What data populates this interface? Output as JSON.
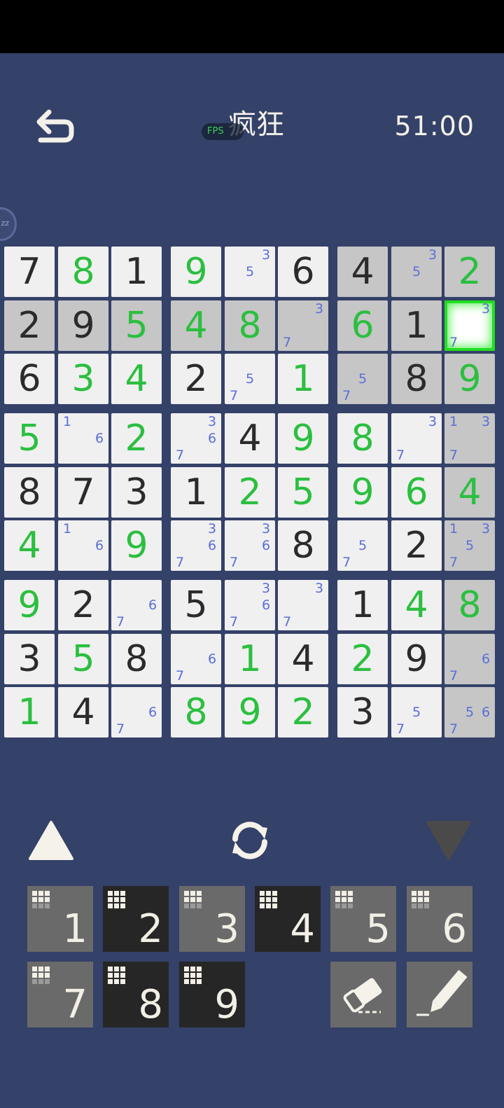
{
  "header": {
    "title": "疯狂",
    "fps_label": "FPS",
    "timer": "51:00",
    "sleep_label": "zz"
  },
  "board": {
    "selected": [
      1,
      8
    ],
    "rows": [
      [
        {
          "v": "7",
          "t": "given"
        },
        {
          "v": "8",
          "t": "user"
        },
        {
          "v": "1",
          "t": "given"
        },
        {
          "v": "9",
          "t": "user"
        },
        {
          "n": [
            "5",
            "3"
          ]
        },
        {
          "v": "6",
          "t": "given"
        },
        {
          "v": "4",
          "t": "given"
        },
        {
          "n": [
            "5",
            "3"
          ]
        },
        {
          "v": "2",
          "t": "user"
        }
      ],
      [
        {
          "v": "2",
          "t": "given"
        },
        {
          "v": "9",
          "t": "given"
        },
        {
          "v": "5",
          "t": "user"
        },
        {
          "v": "4",
          "t": "user"
        },
        {
          "v": "8",
          "t": "user"
        },
        {
          "n": [
            "3",
            "7"
          ]
        },
        {
          "v": "6",
          "t": "user"
        },
        {
          "v": "1",
          "t": "given"
        },
        {
          "n": [
            "3",
            "7"
          ]
        }
      ],
      [
        {
          "v": "6",
          "t": "given"
        },
        {
          "v": "3",
          "t": "user"
        },
        {
          "v": "4",
          "t": "user"
        },
        {
          "v": "2",
          "t": "given"
        },
        {
          "n": [
            "5",
            "7"
          ]
        },
        {
          "v": "1",
          "t": "user"
        },
        {
          "n": [
            "5",
            "7"
          ]
        },
        {
          "v": "8",
          "t": "given"
        },
        {
          "v": "9",
          "t": "user"
        }
      ],
      [
        {
          "v": "5",
          "t": "user"
        },
        {
          "n": [
            "1",
            "6"
          ]
        },
        {
          "v": "2",
          "t": "user"
        },
        {
          "n": [
            "3",
            "6",
            "7"
          ]
        },
        {
          "v": "4",
          "t": "given"
        },
        {
          "v": "9",
          "t": "user"
        },
        {
          "v": "8",
          "t": "user"
        },
        {
          "n": [
            "3",
            "7"
          ]
        },
        {
          "n": [
            "1",
            "3",
            "7"
          ]
        }
      ],
      [
        {
          "v": "8",
          "t": "given"
        },
        {
          "v": "7",
          "t": "given"
        },
        {
          "v": "3",
          "t": "given"
        },
        {
          "v": "1",
          "t": "given"
        },
        {
          "v": "2",
          "t": "user"
        },
        {
          "v": "5",
          "t": "user"
        },
        {
          "v": "9",
          "t": "user"
        },
        {
          "v": "6",
          "t": "user"
        },
        {
          "v": "4",
          "t": "user"
        }
      ],
      [
        {
          "v": "4",
          "t": "user"
        },
        {
          "n": [
            "1",
            "6"
          ]
        },
        {
          "v": "9",
          "t": "user"
        },
        {
          "n": [
            "3",
            "6",
            "7"
          ]
        },
        {
          "n": [
            "3",
            "6",
            "7"
          ]
        },
        {
          "v": "8",
          "t": "given"
        },
        {
          "n": [
            "5",
            "7"
          ]
        },
        {
          "v": "2",
          "t": "given"
        },
        {
          "n": [
            "1",
            "3",
            "5",
            "7"
          ]
        }
      ],
      [
        {
          "v": "9",
          "t": "user"
        },
        {
          "v": "2",
          "t": "given"
        },
        {
          "n": [
            "6",
            "7"
          ]
        },
        {
          "v": "5",
          "t": "given"
        },
        {
          "n": [
            "3",
            "6",
            "7"
          ]
        },
        {
          "n": [
            "3",
            "7"
          ]
        },
        {
          "v": "1",
          "t": "given"
        },
        {
          "v": "4",
          "t": "user"
        },
        {
          "v": "8",
          "t": "user"
        }
      ],
      [
        {
          "v": "3",
          "t": "given"
        },
        {
          "v": "5",
          "t": "user"
        },
        {
          "v": "8",
          "t": "given"
        },
        {
          "n": [
            "6",
            "7"
          ]
        },
        {
          "v": "1",
          "t": "user"
        },
        {
          "v": "4",
          "t": "given"
        },
        {
          "v": "2",
          "t": "user"
        },
        {
          "v": "9",
          "t": "given"
        },
        {
          "n": [
            "6",
            "7"
          ]
        }
      ],
      [
        {
          "v": "1",
          "t": "user"
        },
        {
          "v": "4",
          "t": "given"
        },
        {
          "n": [
            "6",
            "7"
          ]
        },
        {
          "v": "8",
          "t": "user"
        },
        {
          "v": "9",
          "t": "user"
        },
        {
          "v": "2",
          "t": "user"
        },
        {
          "v": "3",
          "t": "given"
        },
        {
          "n": [
            "5",
            "7"
          ]
        },
        {
          "n": [
            "5",
            "6",
            "7"
          ]
        }
      ]
    ]
  },
  "controls": {
    "arrow_up_icon": "arrow-up-icon",
    "refresh_icon": "refresh-icon",
    "arrow_down_icon": "arrow-down-icon",
    "colors": {
      "up": "#f5f2ea",
      "down": "#4a4a4a",
      "note": "#5b6ed6",
      "user_digit": "#2bbf3f",
      "given_digit": "#2b2b2b",
      "select": "#22dd22"
    }
  },
  "keypad": {
    "keys": [
      {
        "label": "1",
        "style": "light",
        "filled": 6
      },
      {
        "label": "2",
        "style": "dark",
        "filled": 9
      },
      {
        "label": "3",
        "style": "light",
        "filled": 6
      },
      {
        "label": "4",
        "style": "dark",
        "filled": 9
      },
      {
        "label": "5",
        "style": "light",
        "filled": 6
      },
      {
        "label": "6",
        "style": "light",
        "filled": 6
      },
      {
        "label": "7",
        "style": "light",
        "filled": 6
      },
      {
        "label": "8",
        "style": "dark",
        "filled": 9
      },
      {
        "label": "9",
        "style": "dark",
        "filled": 9
      }
    ],
    "eraser_icon": "eraser-icon",
    "pencil_icon": "pencil-icon"
  }
}
